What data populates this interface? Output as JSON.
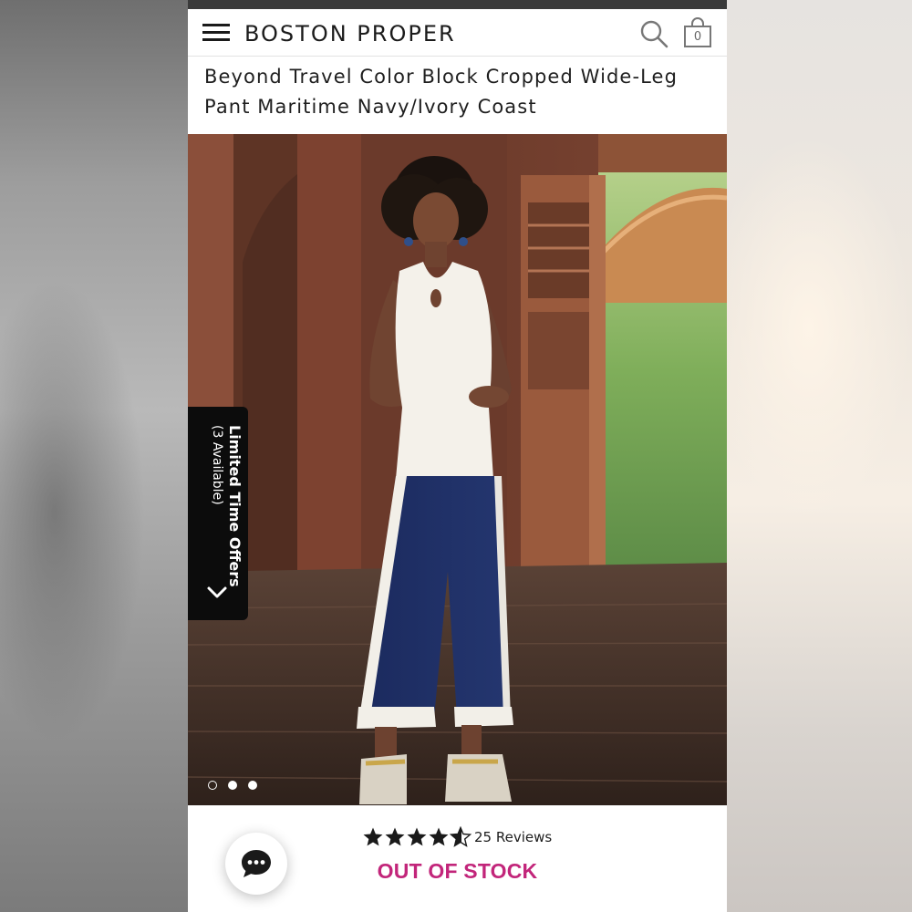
{
  "brand": {
    "name": "BOSTON PROPER"
  },
  "header": {
    "cart_count": "0",
    "icons": [
      "menu-icon",
      "search-icon",
      "shopping-bag-icon"
    ]
  },
  "product": {
    "title_line1": "Beyond Travel Color Block Cropped Wide-Leg",
    "title_line2": "Pant Maritime Navy/Ivory Coast",
    "rating": 4.5,
    "rating_max": 5,
    "reviews_label": "25 Reviews",
    "stock_status": "OUT OF STOCK"
  },
  "offers_tab": {
    "title": "Limited Time Offers",
    "subtitle": "(3 Available)"
  },
  "carousel": {
    "image_count": 3,
    "active_index": 0
  },
  "colors": {
    "out_of_stock": "#c2257a",
    "header_text": "#1b1b1b",
    "offers_tab_bg": "#0c0c0c"
  }
}
